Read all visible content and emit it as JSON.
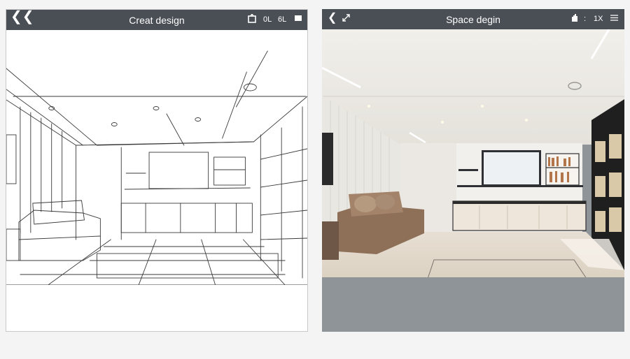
{
  "left_panel": {
    "title": "Creat design",
    "back_icon": "double-chevron-left-icon",
    "toolbar": {
      "frame_icon": "frame-icon",
      "label_a": "0L",
      "label_b": "6L",
      "rect_icon": "rectangle-icon"
    }
  },
  "right_panel": {
    "title": "Space degin",
    "back_icon": "chevron-left-icon",
    "toolbar": {
      "collapse_icon": "diagonal-arrows-icon",
      "glove_icon": "glove-icon",
      "sep": ":",
      "label": "1X",
      "menu_icon": "menu-icon"
    }
  },
  "colors": {
    "header_bg": "#4a4f56",
    "footer_gray": "#8f9499",
    "sketch_line": "#3a3a3a"
  }
}
